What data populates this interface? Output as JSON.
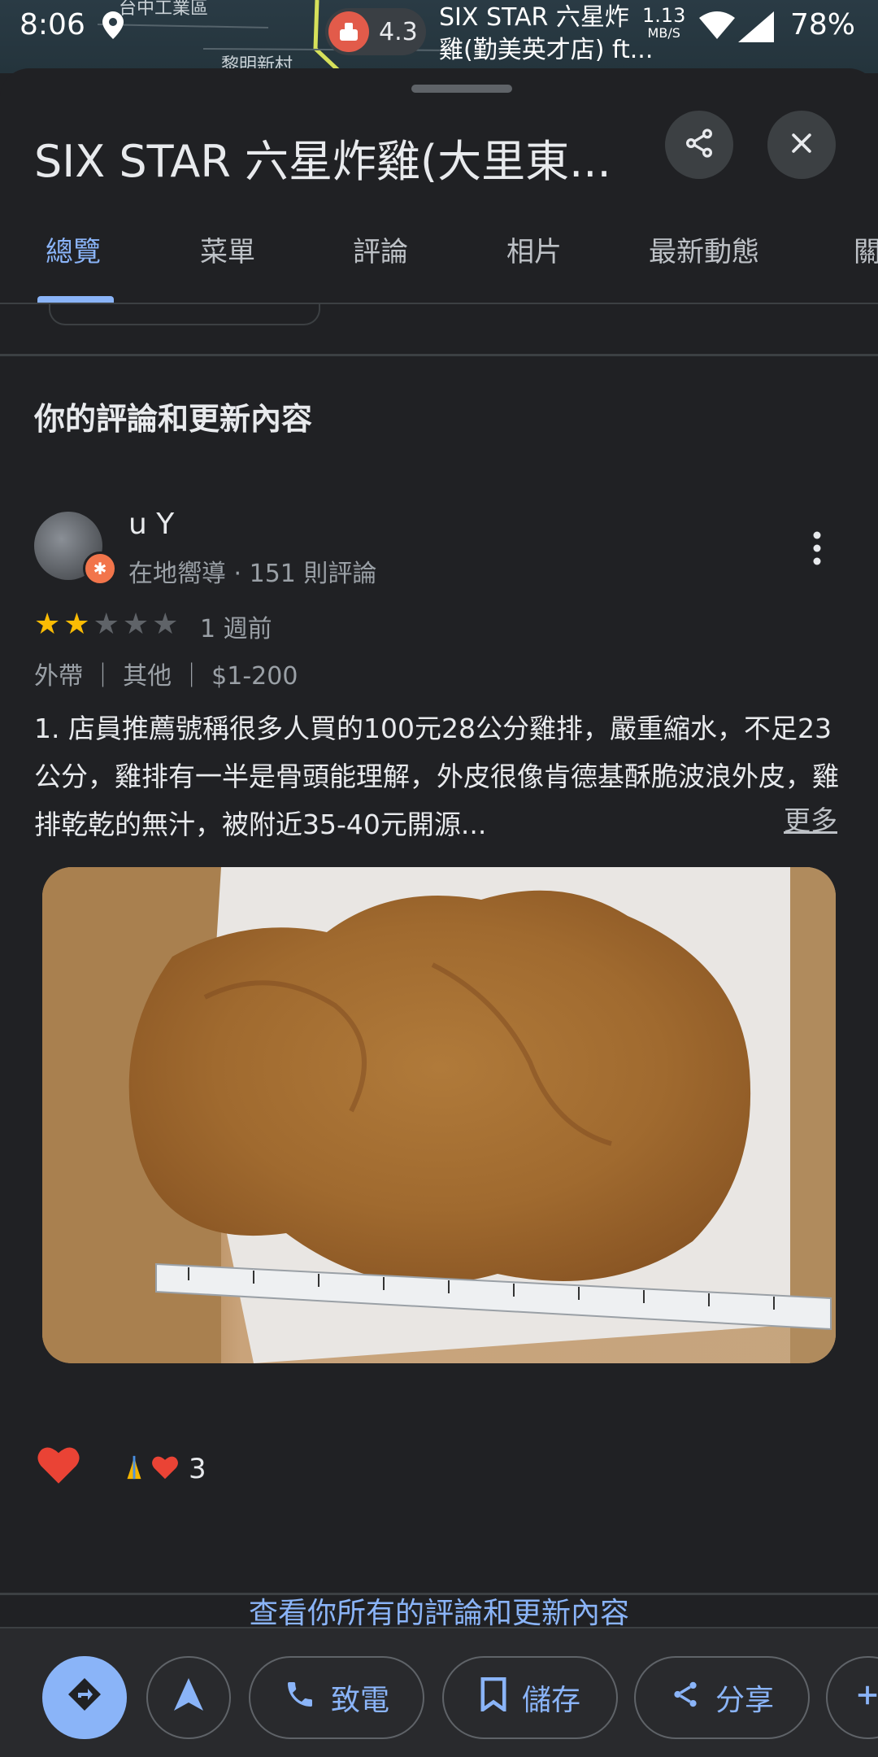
{
  "status_bar": {
    "time": "8:06",
    "rating": "4.3",
    "place_line1": "SIX STAR 六星炸",
    "place_line2": "雞(勤美英才店) ft...",
    "speed_value": "1.13",
    "speed_unit": "MB/S",
    "battery": "78%"
  },
  "map_labels": [
    "台中工業區",
    "黎明新村"
  ],
  "header": {
    "title": "SIX STAR 六星炸雞(大里東...",
    "share_icon": "share-icon",
    "close_icon": "close-icon"
  },
  "tabs": [
    {
      "label": "總覽",
      "active": true
    },
    {
      "label": "菜單"
    },
    {
      "label": "評論"
    },
    {
      "label": "相片"
    },
    {
      "label": "最新動態"
    },
    {
      "label": "關"
    }
  ],
  "section": {
    "title": "你的評論和更新內容"
  },
  "review": {
    "author": "u Y",
    "meta": "在地嚮導 · 151 則評論",
    "rating": 2,
    "rating_max": 5,
    "when": "1 週前",
    "tags": "外帶 ｜ 其他 ｜ $1-200",
    "text": "1. 店員推薦號稱很多人買的100元28公分雞排，嚴重縮水，不足23公分，雞排有一半是骨頭能理解，外皮很像肯德基酥脆波浪外皮，雞排乾乾的無汁，被附近35-40元開源...",
    "more_label": "更多",
    "reaction_count": "3"
  },
  "see_all_label": "查看你所有的評論和更新內容",
  "bottom_bar": {
    "call_label": "致電",
    "save_label": "儲存",
    "share_label": "分享"
  },
  "colors": {
    "background": "#202124",
    "accent": "#8ab4f8",
    "star": "#fbbc04",
    "badge": "#f2754b"
  }
}
